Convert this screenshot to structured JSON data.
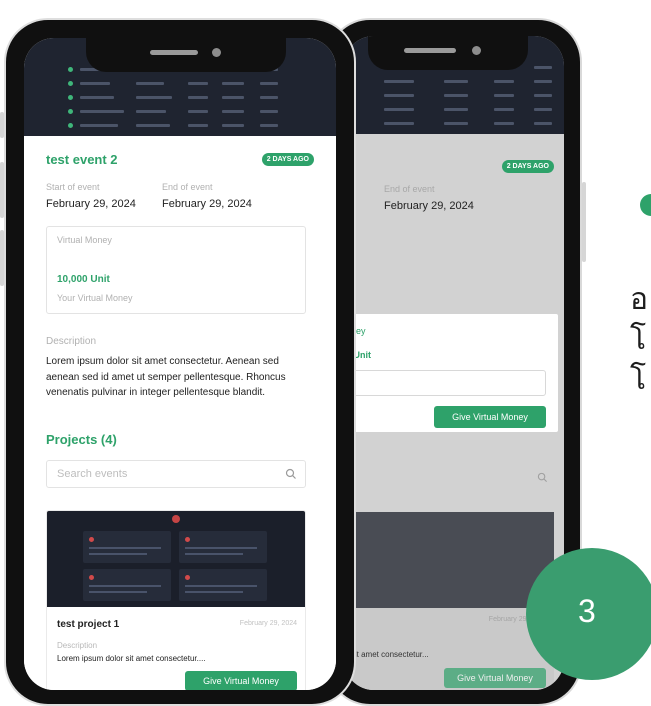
{
  "colors": {
    "accent": "#2ea26a",
    "dark_ui": "#1f2430",
    "overlay": "#d2d2d2"
  },
  "front": {
    "event": {
      "title": "test event 2",
      "badge": "2 DAYS AGO",
      "start_label": "Start of event",
      "start_date": "February 29, 2024",
      "end_label": "End of event",
      "end_date": "February 29, 2024"
    },
    "virtual_money": {
      "label": "Virtual Money",
      "amount": "10,000 Unit",
      "caption": "Your Virtual Money"
    },
    "description": {
      "label": "Description",
      "text": "Lorem ipsum dolor sit amet consectetur. Aenean sed aenean sed id amet ut semper pellentesque. Rhoncus venenatis pulvinar in integer pellentesque blandit."
    },
    "projects": {
      "title": "Projects (4)",
      "search_placeholder": "Search events",
      "search_icon": "search-icon",
      "items": [
        {
          "name": "test project 1",
          "date": "February 29, 2024",
          "desc_label": "Description",
          "desc": "Lorem ipsum dolor sit amet consectetur....",
          "button": "Give Virtual Money"
        }
      ]
    }
  },
  "back": {
    "badge": "2 DAYS AGO",
    "end_label": "End of event",
    "end_date": "February 29, 2024",
    "modal_label": "oney",
    "modal_amount": "0 Unit",
    "modal_button": "Give Virtual Money",
    "card_date": "February 29, 2024",
    "card_desc": "r sit amet consectetur...",
    "card_button": "Give Virtual Money"
  },
  "side": {
    "thai_1": "อ",
    "thai_2": "โ",
    "thai_3": "โ",
    "step_number": "3"
  }
}
